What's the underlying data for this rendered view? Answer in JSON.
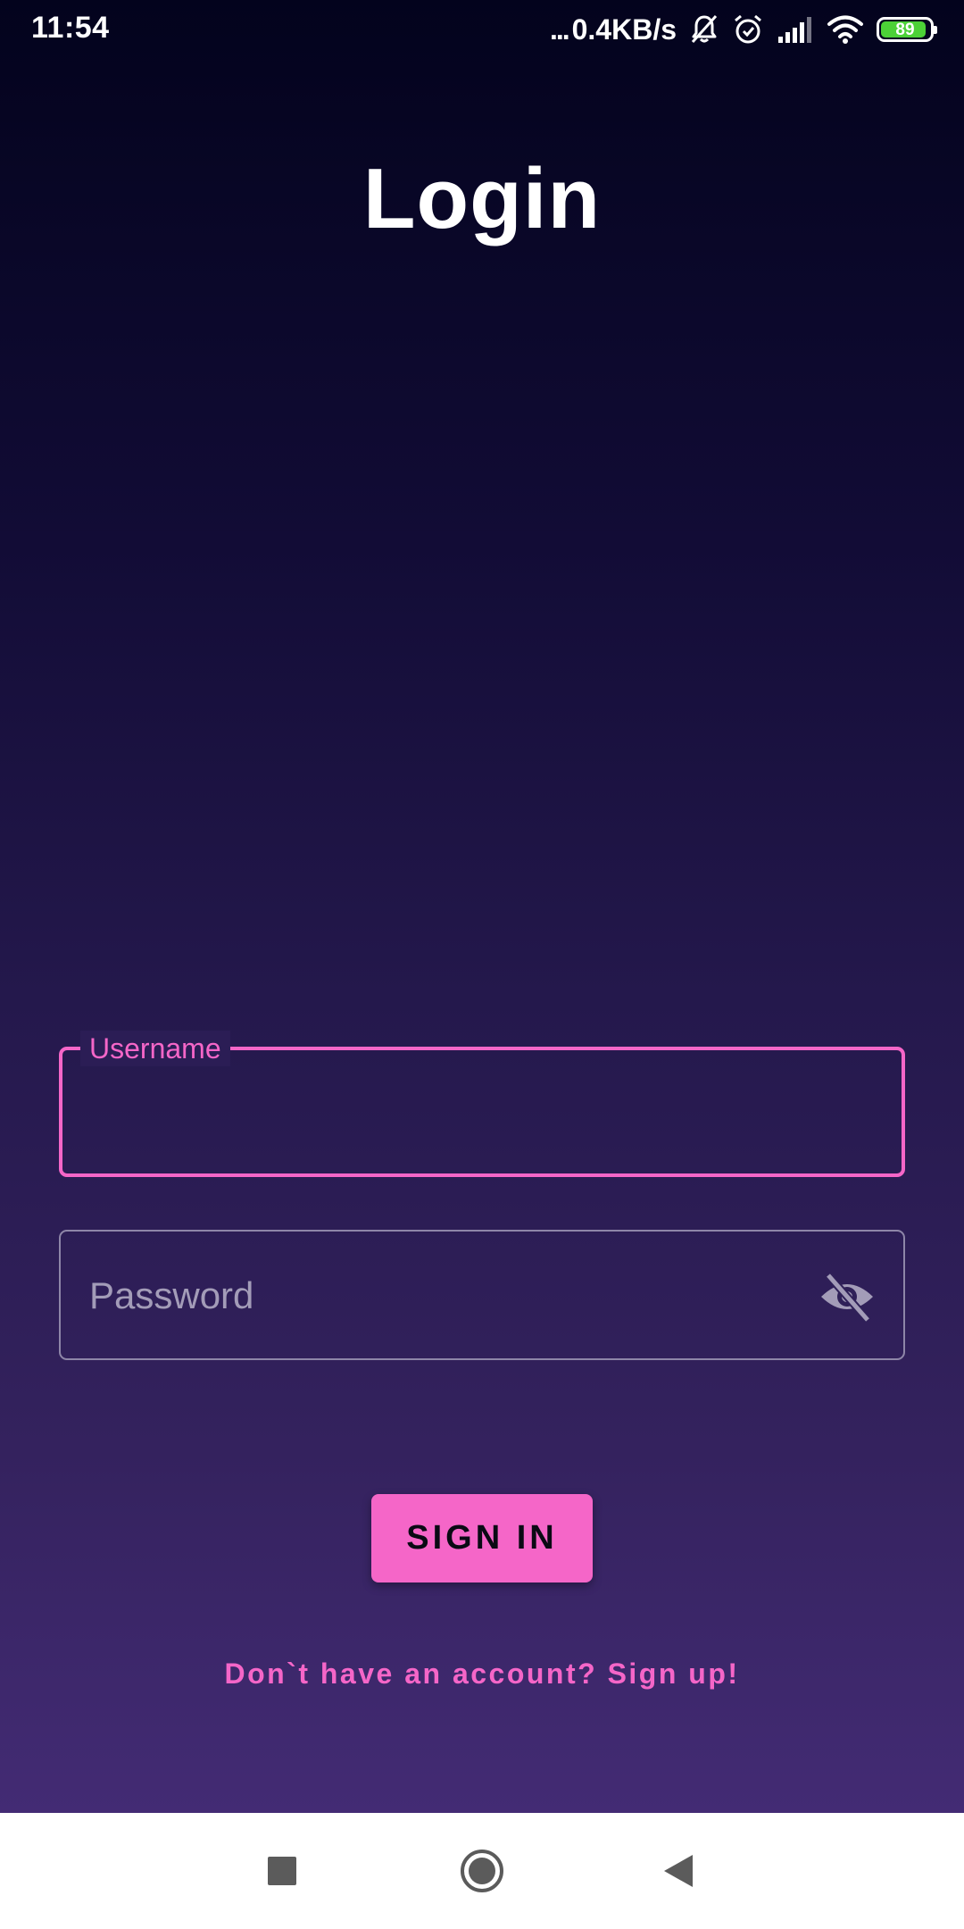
{
  "status_bar": {
    "time": "11:54",
    "dots": "...",
    "network_speed": "0.4KB/s",
    "battery_level": "89",
    "icons": [
      "notifications-off-icon",
      "alarm-icon",
      "signal-icon",
      "wifi-icon",
      "battery-icon"
    ]
  },
  "page": {
    "title": "Login"
  },
  "form": {
    "username_label": "Username",
    "username_value": "",
    "password_placeholder": "Password",
    "password_value": "",
    "visibility_icon": "eye-off-icon",
    "sign_in_label": "SIGN IN",
    "signup_link_text": "Don`t have an account? Sign up!"
  },
  "nav_bar": {
    "icons": [
      "recents-square-icon",
      "home-circle-icon",
      "back-triangle-icon"
    ]
  },
  "colors": {
    "accent": "#f566c8",
    "background_top": "#03031d",
    "background_bottom": "#432b74",
    "field_outline": "#8e86a8",
    "battery": "#4cd137"
  }
}
